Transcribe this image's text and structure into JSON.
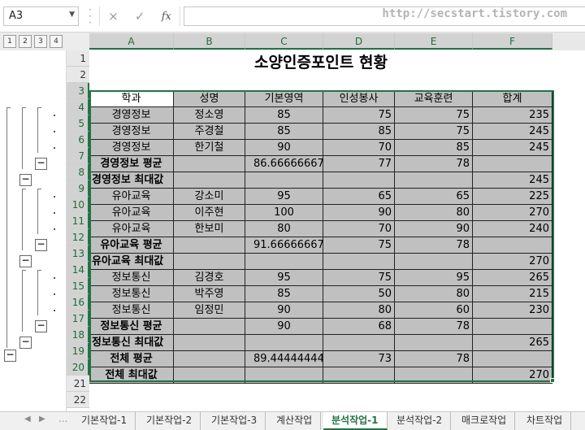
{
  "formula_bar": {
    "name_box": "A3",
    "cancel_icon": "×",
    "enter_icon": "✓",
    "fx_label": "fx",
    "formula": "",
    "watermark": "http://secstart.tistory.com"
  },
  "outline_levels": [
    "1",
    "2",
    "3",
    "4"
  ],
  "columns": [
    "A",
    "B",
    "C",
    "D",
    "E",
    "F"
  ],
  "rows": [
    "1",
    "2",
    "3",
    "4",
    "5",
    "6",
    "7",
    "8",
    "9",
    "10",
    "11",
    "12",
    "13",
    "14",
    "15",
    "16",
    "17",
    "18",
    "19",
    "20",
    "21",
    "22"
  ],
  "sheet": {
    "title": "소양인증포인트 현황",
    "headers": [
      "학과",
      "성명",
      "기본영역",
      "인성봉사",
      "교육훈련",
      "합계"
    ],
    "rows": [
      [
        "경영정보",
        "정소영",
        "85",
        "75",
        "75",
        "235"
      ],
      [
        "경영정보",
        "주경철",
        "85",
        "85",
        "75",
        "245"
      ],
      [
        "경영정보",
        "한기철",
        "90",
        "70",
        "85",
        "245"
      ],
      [
        "경영정보 평균",
        "",
        "86.66666667",
        "77",
        "78",
        ""
      ],
      [
        "경영정보 최대값",
        "",
        "",
        "",
        "",
        "245"
      ],
      [
        "유아교육",
        "강소미",
        "95",
        "65",
        "65",
        "225"
      ],
      [
        "유아교육",
        "이주현",
        "100",
        "90",
        "80",
        "270"
      ],
      [
        "유아교육",
        "한보미",
        "80",
        "70",
        "90",
        "240"
      ],
      [
        "유아교육 평균",
        "",
        "91.66666667",
        "75",
        "78",
        ""
      ],
      [
        "유아교육 최대값",
        "",
        "",
        "",
        "",
        "270"
      ],
      [
        "정보통신",
        "김경호",
        "95",
        "75",
        "95",
        "265"
      ],
      [
        "정보통신",
        "박주영",
        "85",
        "50",
        "80",
        "215"
      ],
      [
        "정보통신",
        "임정민",
        "90",
        "80",
        "60",
        "230"
      ],
      [
        "정보통신 평균",
        "",
        "90",
        "68",
        "78",
        ""
      ],
      [
        "정보통신 최대값",
        "",
        "",
        "",
        "",
        "265"
      ],
      [
        "전체 평균",
        "",
        "89.44444444",
        "73",
        "78",
        ""
      ],
      [
        "전체 최대값",
        "",
        "",
        "",
        "",
        "270"
      ]
    ]
  },
  "sheet_tabs": [
    "기본작업-1",
    "기본작업-2",
    "기본작업-3",
    "계산작업",
    "분석작업-1",
    "분석작업-2",
    "매크로작업",
    "차트작업"
  ],
  "active_tab": "분석작업-1",
  "outline_collapse_symbol": "−",
  "tab_overflow": "..."
}
